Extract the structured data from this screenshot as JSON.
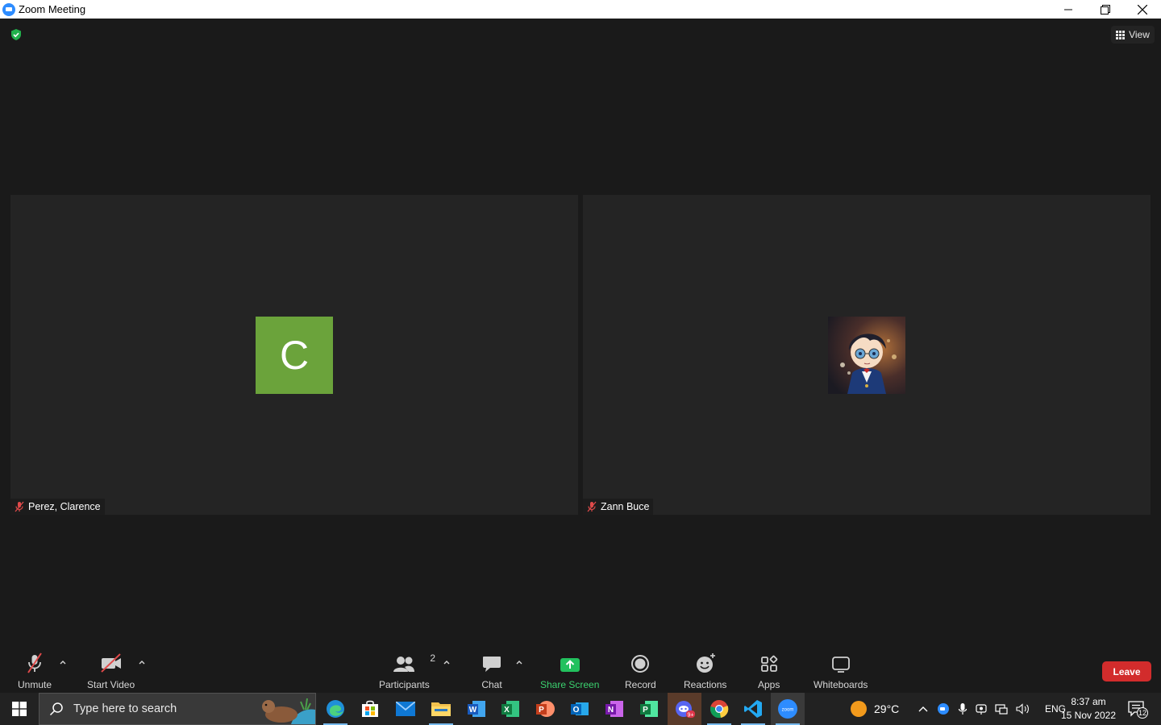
{
  "window": {
    "title": "Zoom Meeting"
  },
  "meeting": {
    "view_label": "View",
    "participants": [
      {
        "name": "Perez, Clarence",
        "initial": "C",
        "avatar_color": "#6ba33b",
        "muted": true
      },
      {
        "name": "Zann Buce",
        "avatar": "anime-character-photo",
        "muted": true
      }
    ]
  },
  "toolbar": {
    "unmute_label": "Unmute",
    "start_video_label": "Start Video",
    "participants_label": "Participants",
    "participants_count": "2",
    "chat_label": "Chat",
    "share_screen_label": "Share Screen",
    "record_label": "Record",
    "reactions_label": "Reactions",
    "apps_label": "Apps",
    "whiteboards_label": "Whiteboards",
    "leave_label": "Leave",
    "share_color": "#3bd16f",
    "leave_color": "#d22c2c"
  },
  "taskbar": {
    "search_placeholder": "Type here to search",
    "apps": [
      "edge-icon",
      "store-icon",
      "mail-icon",
      "file-explorer-icon",
      "word-icon",
      "excel-icon",
      "powerpoint-icon",
      "outlook-icon",
      "onenote-icon",
      "project-icon",
      "discord-icon",
      "chrome-icon",
      "vscode-icon",
      "zoom-icon"
    ],
    "weather_temp": "29°C",
    "language": "ENG",
    "time": "8:37 am",
    "date": "15 Nov 2022",
    "notification_count": "12"
  }
}
